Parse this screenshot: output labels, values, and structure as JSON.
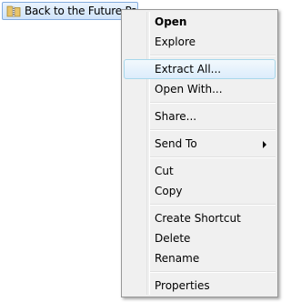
{
  "file": {
    "name": "Back to the Future Part II",
    "icon": "zip-folder-icon"
  },
  "context_menu": {
    "items": [
      {
        "label": "Open",
        "bold": true
      },
      {
        "label": "Explore"
      },
      {
        "label": "Extract All...",
        "highlighted": true
      },
      {
        "label": "Open With..."
      },
      {
        "label": "Share..."
      },
      {
        "label": "Send To",
        "submenu": true
      },
      {
        "label": "Cut"
      },
      {
        "label": "Copy"
      },
      {
        "label": "Create Shortcut"
      },
      {
        "label": "Delete"
      },
      {
        "label": "Rename"
      },
      {
        "label": "Properties"
      }
    ]
  },
  "colors": {
    "menu_background": "#f0f0f0",
    "menu_border": "#979797",
    "highlight_border": "#a8d8eb",
    "selection_border": "#84acdd"
  }
}
